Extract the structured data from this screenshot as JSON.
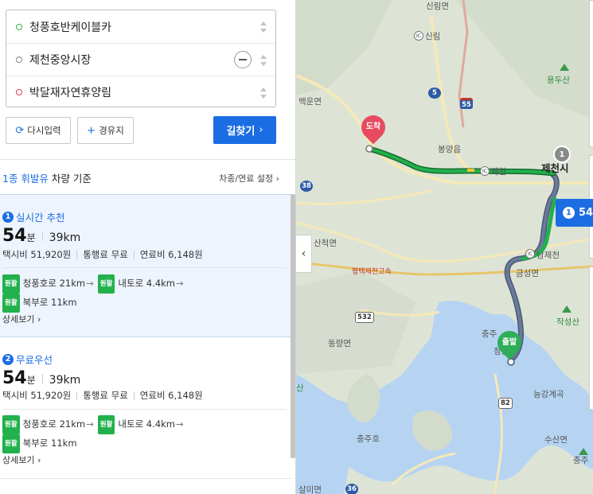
{
  "route_inputs": {
    "start": "청풍호반케이블카",
    "waypoint": "제천중앙시장",
    "destination": "박달재자연휴양림"
  },
  "buttons": {
    "reset": "다시입력",
    "add_waypoint": "경유지",
    "search": "길찾기"
  },
  "criteria": {
    "vehicle_class": "1종 휘발유",
    "suffix": "차량 기준",
    "settings_link": "차종/연료 설정"
  },
  "results": [
    {
      "index": "1",
      "title": "실시간 추천",
      "time_value": "54",
      "time_unit": "분",
      "distance": "39km",
      "taxi": "택시비 51,920원",
      "toll": "통행료 무료",
      "fuel": "연료비 6,148원",
      "tag": "원활",
      "road1": "청풍호로 21km",
      "road2": "내토로 4.4km",
      "road3": "북부로 11km",
      "detail": "상세보기"
    },
    {
      "index": "2",
      "title": "무료우선",
      "time_value": "54",
      "time_unit": "분",
      "distance": "39km",
      "taxi": "택시비 51,920원",
      "toll": "통행료 무료",
      "fuel": "연료비 6,148원",
      "tag": "원활",
      "road1": "청풍호로 21km",
      "road2": "내토로 4.4km",
      "road3": "북부로 11km",
      "detail": "상세보기"
    }
  ],
  "map": {
    "labels": {
      "sillimmyeon": "신림면",
      "ic_sillim": "신림",
      "yongdusan": "용두산",
      "baekunmyeon": "백운면",
      "bongyangeup": "봉양읍",
      "ic_jecheon": "제천",
      "jecheonsi": "제천시",
      "sancheokmyeon": "산척면",
      "ic_namjecheon": "남제천",
      "geumseongmyeon": "금성면",
      "expressway": "평택제천고속",
      "jakseongsan": "작성산",
      "donglyangmyeon": "동량면",
      "chungju": "충주",
      "cheongpungmyeon": "청풍면",
      "geunggangjegok": "능강계곡",
      "susanmyeon": "수산면",
      "chungjuho": "충주호",
      "chungju2": "충주",
      "salmimyeon": "살미면",
      "mountain_left": "산"
    },
    "shields": {
      "r5": "5",
      "r55": "55",
      "r38": "38",
      "r532": "532",
      "r82": "82",
      "r36": "36"
    },
    "ic_label": "IC",
    "pin_destination": "도착",
    "pin_start": "출발",
    "waypoint_number": "1",
    "route_badge_number": "1",
    "route_badge_time": "54",
    "route_color_primary": "#22b14c",
    "route_color_secondary": "#4a5a78"
  }
}
